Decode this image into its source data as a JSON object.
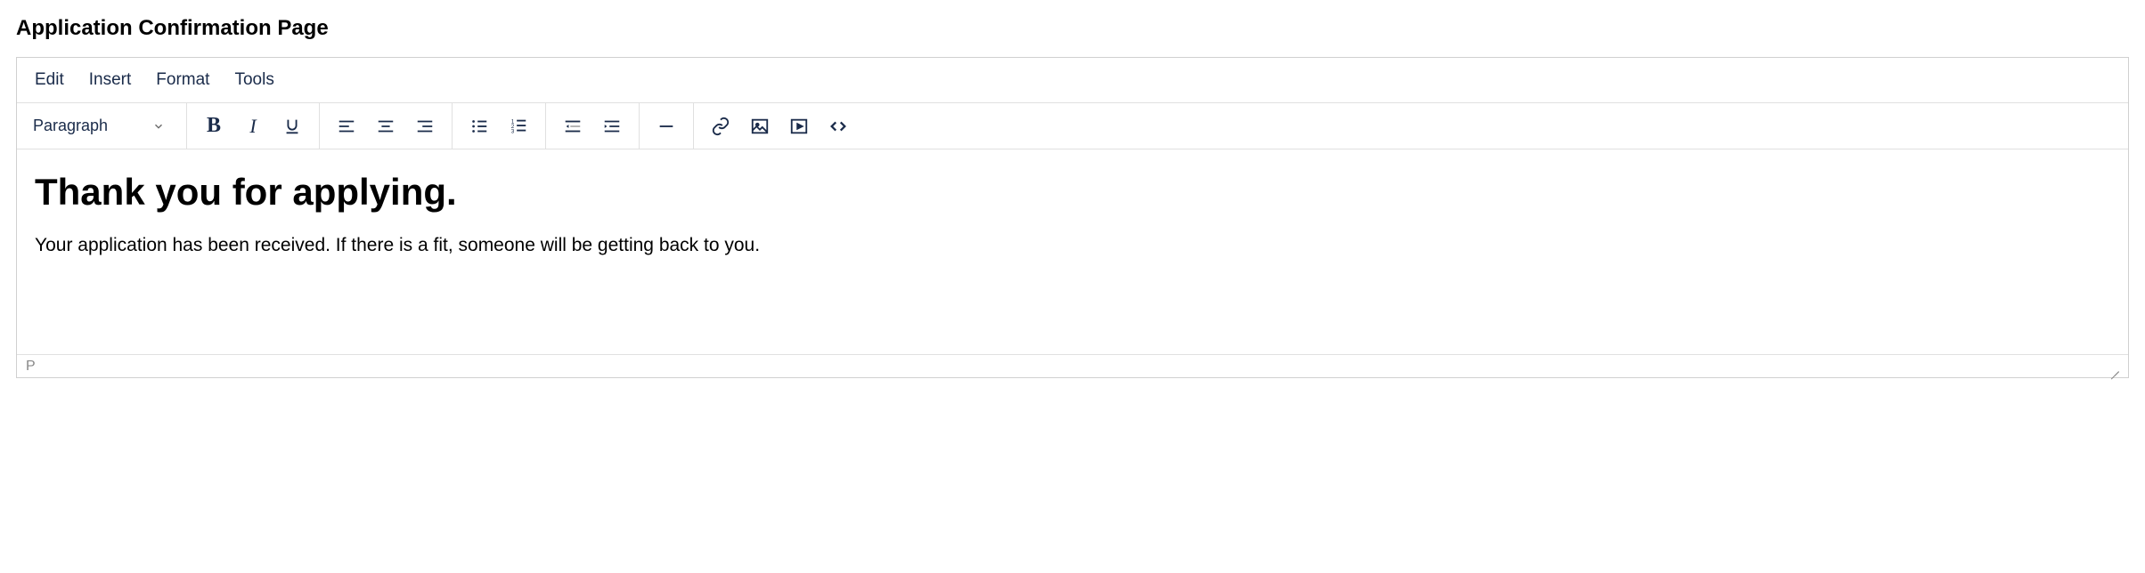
{
  "page_title": "Application Confirmation Page",
  "menu": {
    "edit": "Edit",
    "insert": "Insert",
    "format": "Format",
    "tools": "Tools"
  },
  "toolbar": {
    "format_select": "Paragraph",
    "bold": "B",
    "italic": "I"
  },
  "content": {
    "heading": "Thank you for applying.",
    "paragraph": "Your application has been received. If there is a fit, someone will be getting back to you."
  },
  "status_bar": {
    "path": "P"
  }
}
